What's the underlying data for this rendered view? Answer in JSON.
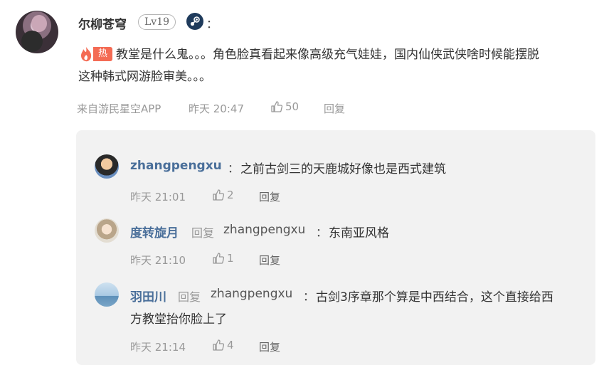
{
  "main_comment": {
    "username": "尔柳苍穹",
    "level": "Lv19",
    "colon": "：",
    "hot_tag": "热",
    "text_line1": "教堂是什么鬼。。。角色脸真看起来像高级充气娃娃，国内仙侠武侠啥时候能摆脱",
    "text_line2": "这种韩式网游脸审美。。。",
    "source": "来自游民星空APP",
    "time": "昨天 20:47",
    "likes": "50",
    "reply_label": "回复"
  },
  "replies": [
    {
      "username": "zhangpengxu",
      "colon": "：",
      "text": "之前古剑三的天鹿城好像也是西式建筑",
      "time": "昨天 21:01",
      "likes": "2",
      "reply_label": "回复"
    },
    {
      "username": "度转旋月",
      "reply_word": "回复",
      "target": "zhangpengxu",
      "colon": "：",
      "text": "东南亚风格",
      "time": "昨天 21:10",
      "likes": "1",
      "reply_label": "回复"
    },
    {
      "username": "羽田川",
      "reply_word": "回复",
      "target": "zhangpengxu",
      "colon": "：",
      "text_line1": "古剑3序章那个算是中西结合，这个直接给西",
      "text_line2": "方教堂抬你脸上了",
      "time": "昨天 21:14",
      "likes": "4",
      "reply_label": "回复"
    }
  ],
  "icons": {
    "platform": "steam-icon",
    "hot": "flame-icon",
    "like": "thumbs-up-icon"
  },
  "colors": {
    "hot": "#f46b54",
    "name_blue": "#4a6f9a",
    "meta_gray": "#999999",
    "reply_bg": "#f2f2f2"
  }
}
